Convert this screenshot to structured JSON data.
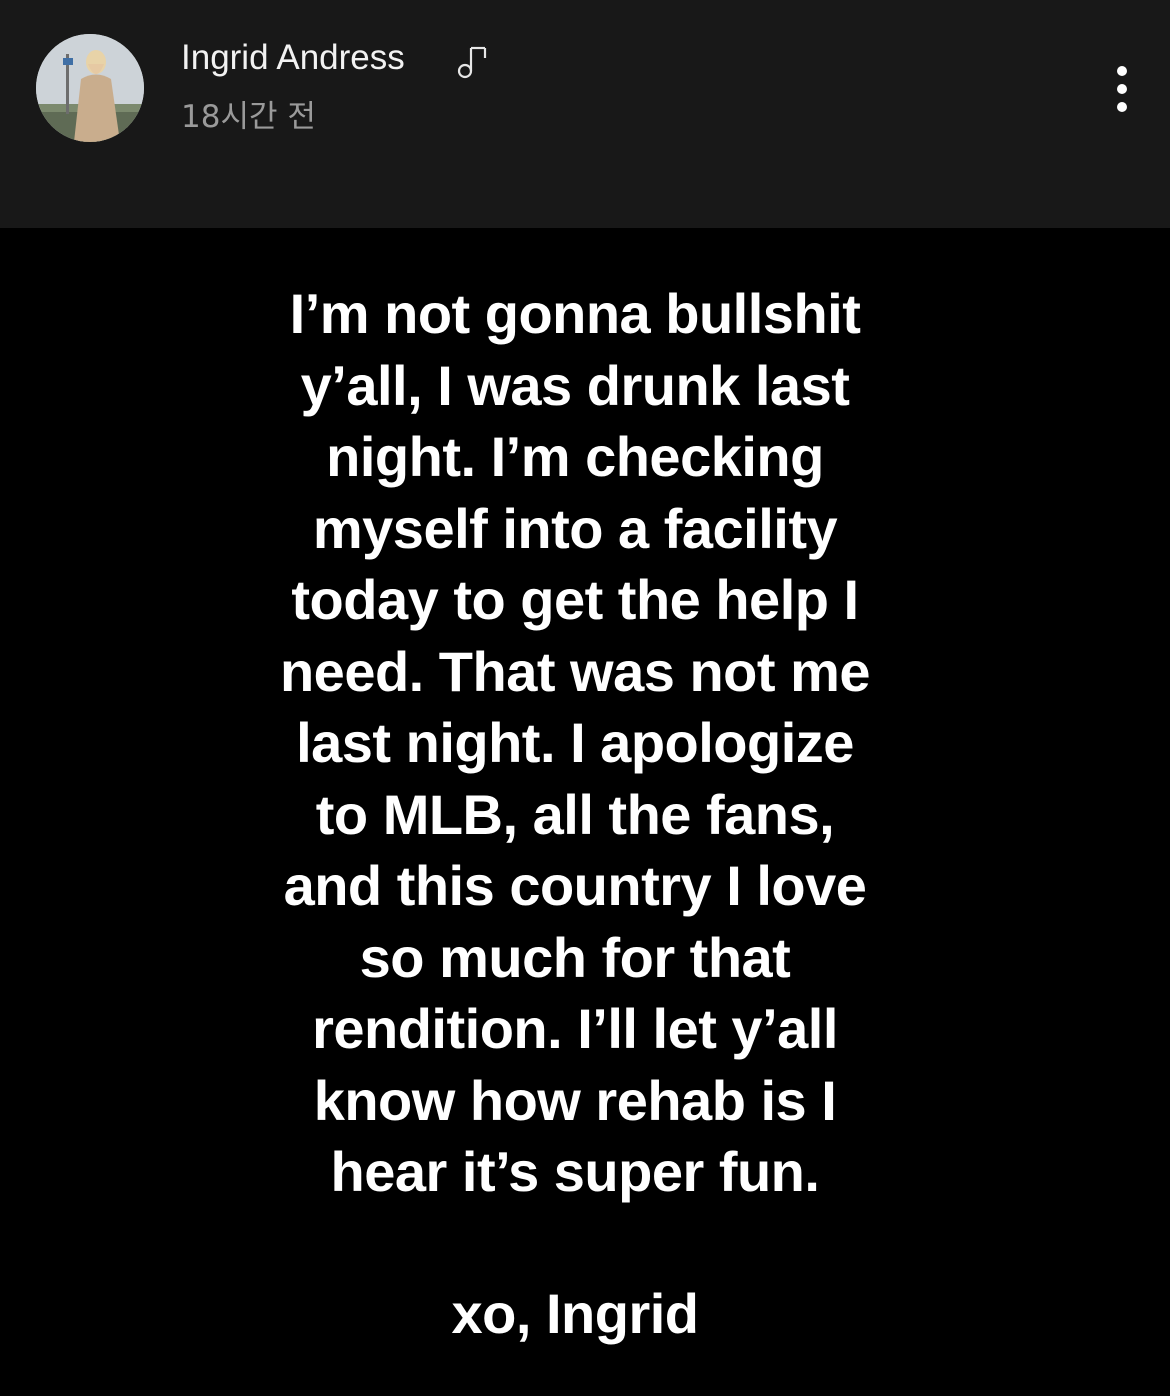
{
  "header": {
    "username": "Ingrid Andress",
    "music_icon": "music-note-icon",
    "timestamp": "18시간 전",
    "more_icon": "more-vertical-icon"
  },
  "story": {
    "body": "I’m not gonna bullshit\ny’all, I was drunk last\nnight. I’m checking\nmyself into a facility\ntoday to get the help I\nneed. That was not me\nlast night. I apologize\nto MLB, all the fans,\nand this country I love\nso much for that\nrendition. I’ll let y’all\nknow how rehab is I\nhear it’s super fun.",
    "signoff": "xo, Ingrid"
  },
  "colors": {
    "header_bg": "#181818",
    "story_bg": "#000000",
    "text": "#ffffff",
    "secondary_text": "#9a9a9a"
  }
}
